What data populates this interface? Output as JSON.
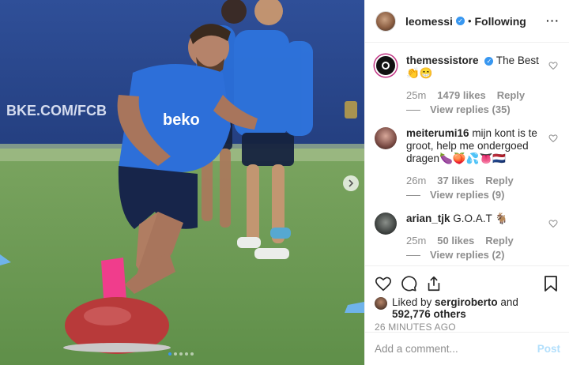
{
  "header": {
    "username": "leomessi",
    "verified_icon": "verified-badge-icon",
    "separator": "•",
    "follow_status": "Following",
    "more_icon": "more-options-icon"
  },
  "photo": {
    "banner_text": "BKE.COM/FCB",
    "shirt_sponsor": "beko",
    "carousel_dots": 5,
    "active_dot": 1
  },
  "comments": [
    {
      "username": "themessistore",
      "verified": true,
      "text": "The Best",
      "emoji": "👏😁",
      "time": "25m",
      "likes": "1479 likes",
      "reply": "Reply",
      "view_replies": "View replies (35)"
    },
    {
      "username": "meiterumi16",
      "verified": false,
      "text": "mijn kont is te groot, help me ondergoed dragen🍆🍑💦👅🇳🇱",
      "time": "26m",
      "likes": "37 likes",
      "reply": "Reply",
      "view_replies": "View replies (9)"
    },
    {
      "username": "arian_tjk",
      "verified": false,
      "text": "G.O.A.T 🐐",
      "time": "25m",
      "likes": "50 likes",
      "reply": "Reply",
      "view_replies": "View replies (2)"
    }
  ],
  "actions": {
    "like_icon": "heart-icon",
    "comment_icon": "comment-icon",
    "share_icon": "share-icon",
    "save_icon": "bookmark-icon"
  },
  "liked_by": {
    "prefix": "Liked by ",
    "user": "sergiroberto",
    "and": " and",
    "others": "592,776 others"
  },
  "timestamp": "26 MINUTES AGO",
  "add_comment": {
    "placeholder": "Add a comment...",
    "post_label": "Post"
  },
  "colors": {
    "accent": "#3897f0",
    "post_disabled": "#b2dffc",
    "muted_text": "#8e8e8e"
  }
}
